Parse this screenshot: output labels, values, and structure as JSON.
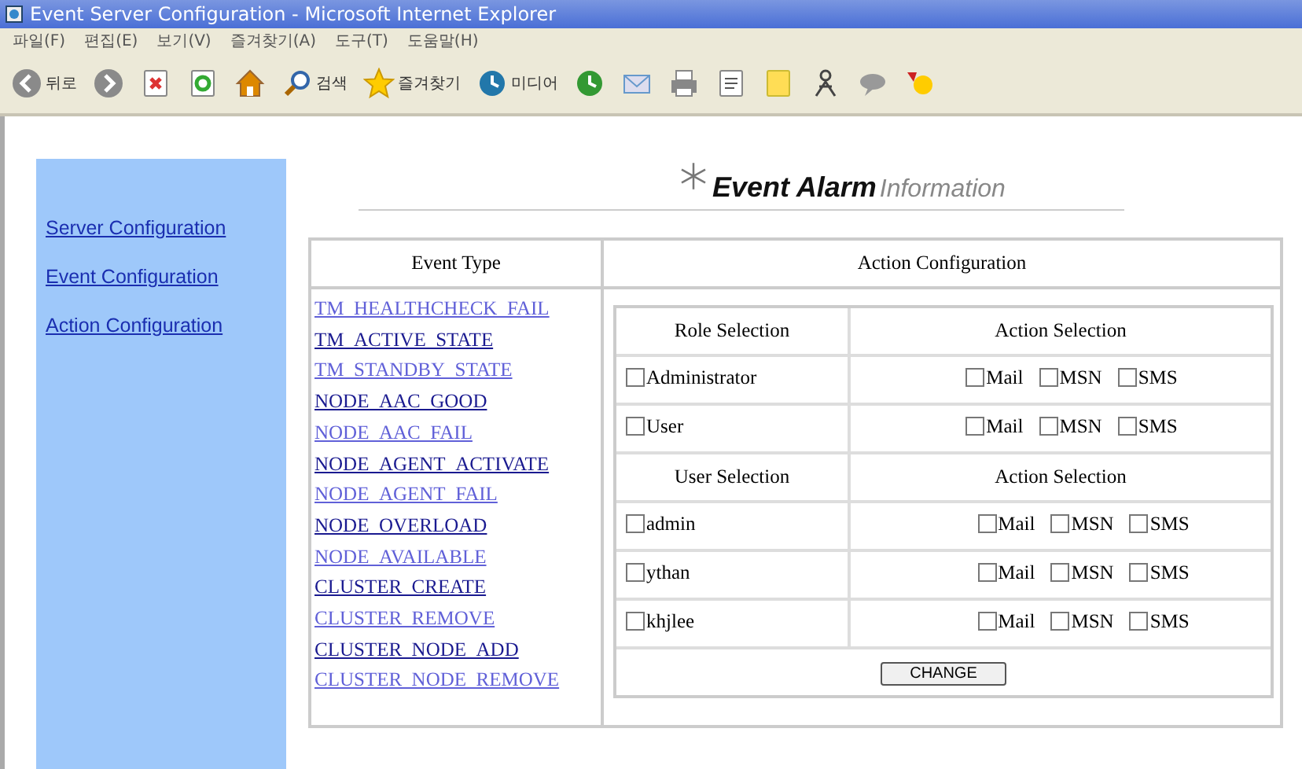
{
  "window": {
    "title": "Event Server Configuration - Microsoft Internet Explorer"
  },
  "menu": [
    "파일(F)",
    "편집(E)",
    "보기(V)",
    "즐겨찾기(A)",
    "도구(T)",
    "도움말(H)"
  ],
  "toolbar": [
    {
      "kind": "back",
      "label": "뒤로"
    },
    {
      "kind": "forward"
    },
    {
      "kind": "stop"
    },
    {
      "kind": "refresh"
    },
    {
      "kind": "home"
    },
    {
      "kind": "search",
      "label": "검색"
    },
    {
      "kind": "favorites",
      "label": "즐겨찾기"
    },
    {
      "kind": "media",
      "label": "미디어"
    },
    {
      "kind": "history"
    },
    {
      "kind": "mail"
    },
    {
      "kind": "print"
    },
    {
      "kind": "edit"
    },
    {
      "kind": "note"
    },
    {
      "kind": "messenger"
    },
    {
      "kind": "discuss"
    },
    {
      "kind": "tool"
    }
  ],
  "sidebar": {
    "items": [
      "Server Configuration",
      "Event Configuration",
      "Action Configuration"
    ]
  },
  "header": {
    "title": "Event Alarm",
    "subtitle": "Information"
  },
  "table": {
    "columns": [
      "Event Type",
      "Action Configuration"
    ],
    "events": [
      {
        "name": "TM_HEALTHCHECK_FAIL",
        "visited": false
      },
      {
        "name": "TM_ACTIVE_STATE",
        "visited": true
      },
      {
        "name": "TM_STANDBY_STATE",
        "visited": false
      },
      {
        "name": "NODE_AAC_GOOD",
        "visited": true
      },
      {
        "name": "NODE_AAC_FAIL",
        "visited": false
      },
      {
        "name": "NODE_AGENT_ACTIVATE",
        "visited": true
      },
      {
        "name": "NODE_AGENT_FAIL",
        "visited": false
      },
      {
        "name": "NODE_OVERLOAD",
        "visited": true
      },
      {
        "name": "NODE_AVAILABLE",
        "visited": false
      },
      {
        "name": "CLUSTER_CREATE",
        "visited": true
      },
      {
        "name": "CLUSTER_REMOVE",
        "visited": false
      },
      {
        "name": "CLUSTER_NODE_ADD",
        "visited": true
      },
      {
        "name": "CLUSTER_NODE_REMOVE",
        "visited": false
      }
    ],
    "sections": [
      {
        "columns": [
          "Role Selection",
          "Action Selection"
        ],
        "rows": [
          {
            "label": "Administrator",
            "checked": false,
            "actions": [
              {
                "label": "Mail",
                "checked": false
              },
              {
                "label": "MSN",
                "checked": false
              },
              {
                "label": "SMS",
                "checked": false
              }
            ]
          },
          {
            "label": "User",
            "checked": false,
            "actions": [
              {
                "label": "Mail",
                "checked": false
              },
              {
                "label": "MSN",
                "checked": false
              },
              {
                "label": "SMS",
                "checked": false
              }
            ]
          }
        ]
      },
      {
        "columns": [
          "User Selection",
          "Action Selection"
        ],
        "rows": [
          {
            "label": "admin",
            "checked": false,
            "actions": [
              {
                "label": "Mail",
                "checked": false
              },
              {
                "label": "MSN",
                "checked": false
              },
              {
                "label": "SMS",
                "checked": false
              }
            ]
          },
          {
            "label": "ythan",
            "checked": false,
            "actions": [
              {
                "label": "Mail",
                "checked": false
              },
              {
                "label": "MSN",
                "checked": false
              },
              {
                "label": "SMS",
                "checked": false
              }
            ]
          },
          {
            "label": "khjlee",
            "checked": false,
            "actions": [
              {
                "label": "Mail",
                "checked": false
              },
              {
                "label": "MSN",
                "checked": false
              },
              {
                "label": "SMS",
                "checked": false
              }
            ]
          }
        ]
      }
    ],
    "button": "CHANGE"
  }
}
